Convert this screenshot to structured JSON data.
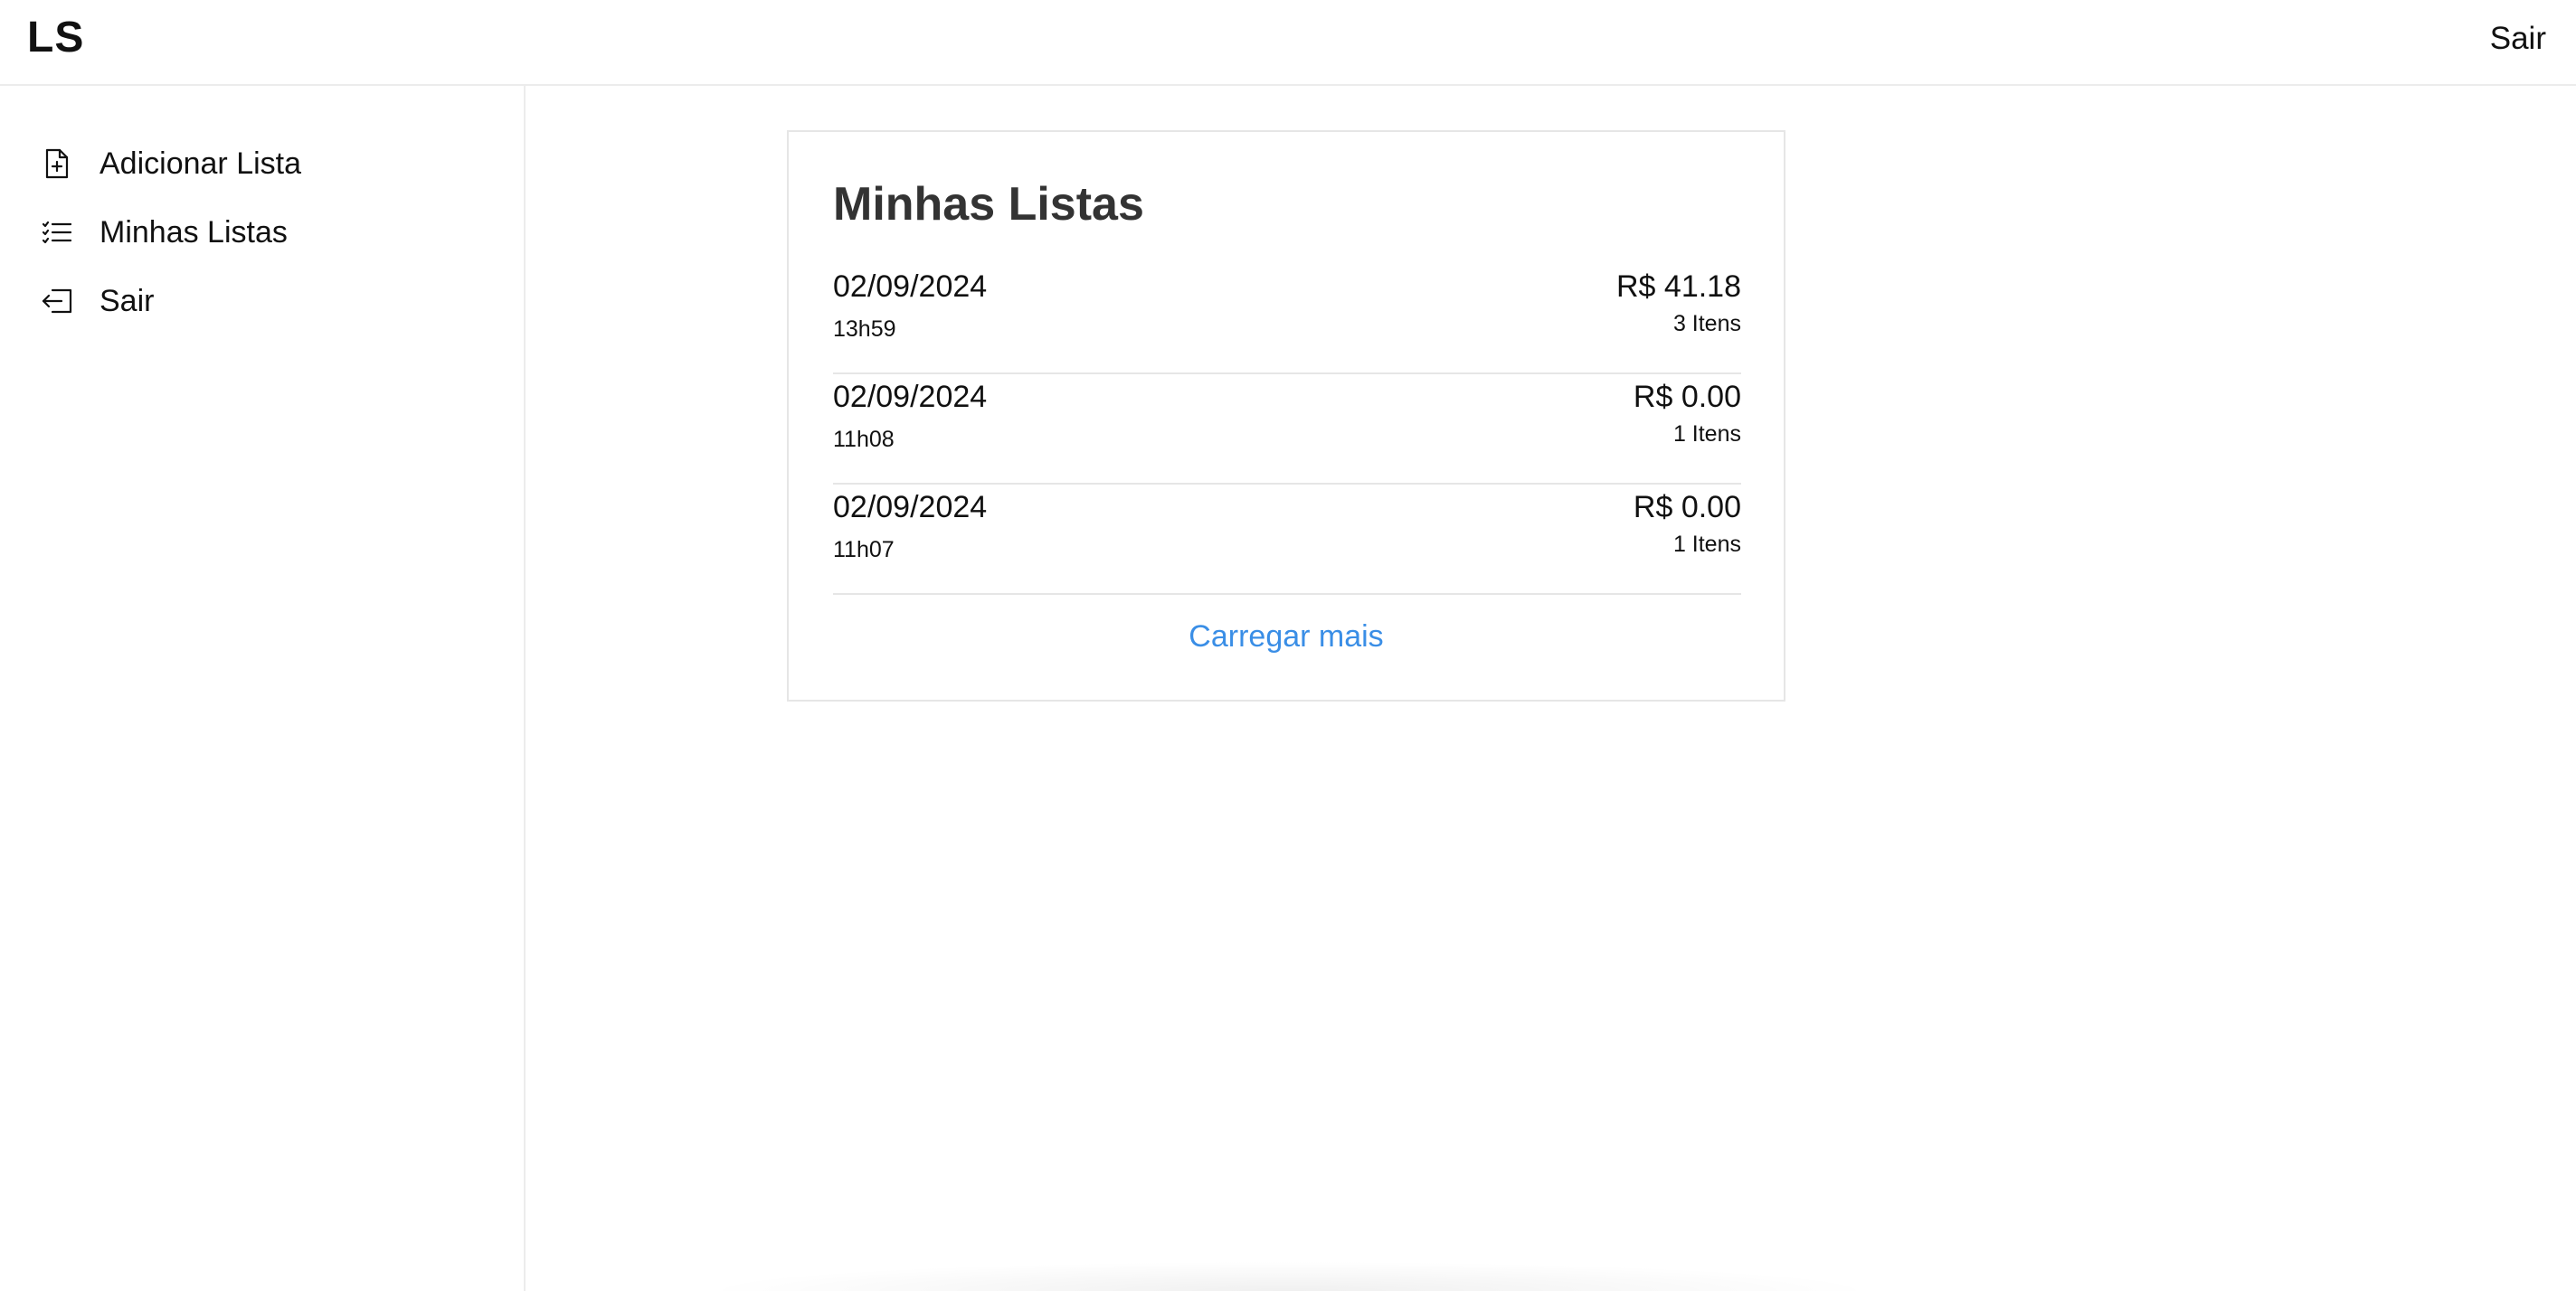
{
  "header": {
    "logo": "LS",
    "logout_label": "Sair"
  },
  "sidebar": {
    "items": [
      {
        "label": "Adicionar Lista",
        "icon": "file-plus-icon"
      },
      {
        "label": "Minhas Listas",
        "icon": "list-checks-icon"
      },
      {
        "label": "Sair",
        "icon": "logout-icon"
      }
    ]
  },
  "main": {
    "title": "Minhas Listas",
    "lists": [
      {
        "date": "02/09/2024",
        "time": "13h59",
        "price": "R$ 41.18",
        "count": "3 Itens"
      },
      {
        "date": "02/09/2024",
        "time": "11h08",
        "price": "R$ 0.00",
        "count": "1 Itens"
      },
      {
        "date": "02/09/2024",
        "time": "11h07",
        "price": "R$ 0.00",
        "count": "1 Itens"
      }
    ],
    "load_more_label": "Carregar mais"
  },
  "colors": {
    "link": "#3a8ee6",
    "title": "#333333",
    "border": "#e6e6e6"
  }
}
